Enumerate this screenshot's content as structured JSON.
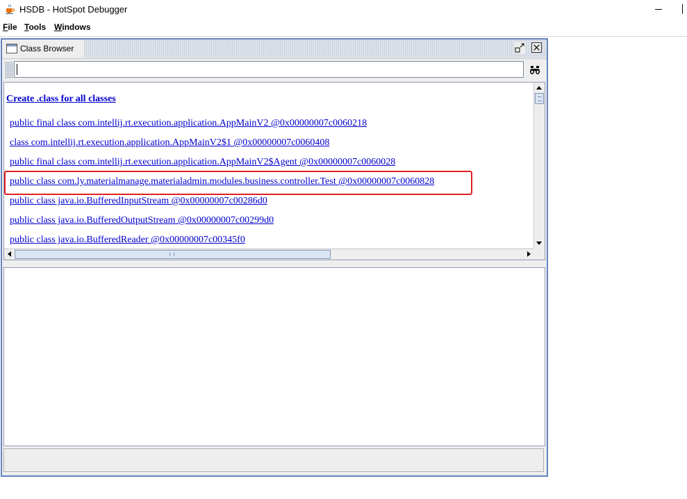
{
  "window": {
    "title": "HSDB - HotSpot Debugger",
    "icon": "java-cup-icon"
  },
  "menubar": {
    "items": [
      {
        "mnemonic": "F",
        "rest": "ile"
      },
      {
        "mnemonic": "T",
        "rest": "ools"
      },
      {
        "mnemonic": "W",
        "rest": "indows"
      }
    ]
  },
  "class_browser": {
    "title": "Class Browser",
    "search": {
      "value": "",
      "placeholder": ""
    },
    "create_link": "Create .class for all classes",
    "classes": [
      "public final class com.intellij.rt.execution.application.AppMainV2 @0x00000007c0060218",
      "class com.intellij.rt.execution.application.AppMainV2$1 @0x00000007c0060408",
      "public final class com.intellij.rt.execution.application.AppMainV2$Agent @0x00000007c0060028",
      "public class com.ly.materialmanage.materialadmin.modules.business.controller.Test @0x00000007c0060828",
      "public class java.io.BufferedInputStream @0x00000007c00286d0",
      "public class java.io.BufferedOutputStream @0x00000007c00299d0",
      "public class java.io.BufferedReader @0x00000007c00345f0"
    ],
    "highlighted_index": 3,
    "highlight_color": "#e02020",
    "link_color": "#0000cc",
    "frame_border_color": "#6382bf"
  }
}
